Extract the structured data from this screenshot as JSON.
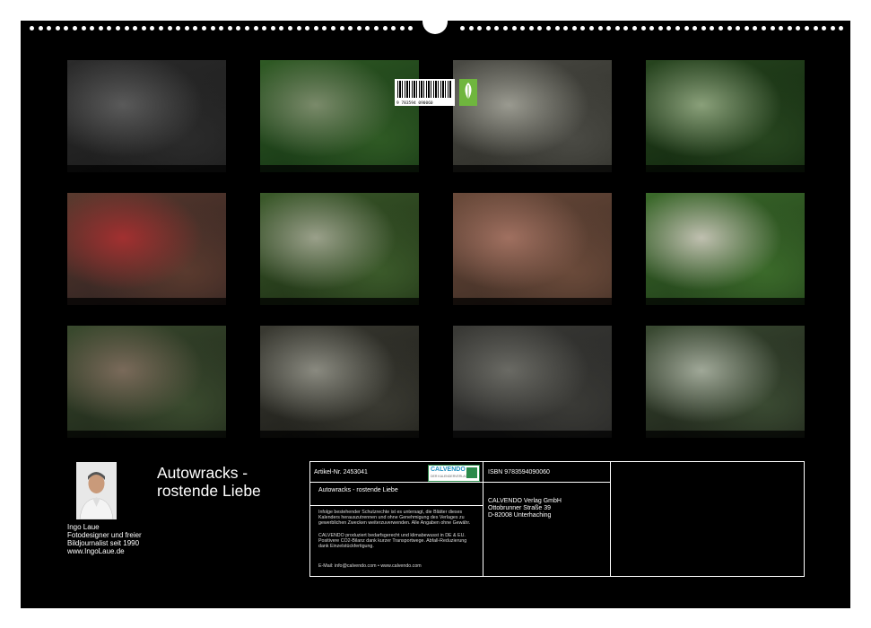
{
  "calendar": {
    "title_line1": "Autowracks -",
    "title_line2": "rostende Liebe",
    "photos": [
      {
        "caption": "",
        "palette": [
          "#2b2b2b",
          "#5a5a5a",
          "#1a1a1a"
        ]
      },
      {
        "caption": "",
        "palette": [
          "#2f5a24",
          "#7a8a6a",
          "#123012"
        ]
      },
      {
        "caption": "",
        "palette": [
          "#4a4a44",
          "#9a9a90",
          "#2a2a24"
        ]
      },
      {
        "caption": "",
        "palette": [
          "#27451f",
          "#8aa07a",
          "#0f240c"
        ]
      },
      {
        "caption": "",
        "palette": [
          "#5a3a2e",
          "#a23030",
          "#2a2020"
        ]
      },
      {
        "caption": "",
        "palette": [
          "#3b5a2a",
          "#9aa08a",
          "#1a2a12"
        ]
      },
      {
        "caption": "",
        "palette": [
          "#6a4a3a",
          "#a07060",
          "#3a2a22"
        ]
      },
      {
        "caption": "",
        "palette": [
          "#3b6a2a",
          "#c0c0b0",
          "#1e3a18"
        ]
      },
      {
        "caption": "",
        "palette": [
          "#3a4a2e",
          "#7a6a5a",
          "#1a2216"
        ]
      },
      {
        "caption": "",
        "palette": [
          "#3a3a32",
          "#8a8a80",
          "#1a1a16"
        ]
      },
      {
        "caption": "",
        "palette": [
          "#3a3a36",
          "#6a6a64",
          "#222"
        ]
      },
      {
        "caption": "",
        "palette": [
          "#3a4a32",
          "#a0a898",
          "#1a1e16"
        ]
      }
    ]
  },
  "author": {
    "name": "Ingo Laue",
    "line2": "Fotodesigner und freier",
    "line3": "Bildjournalist seit 1990",
    "line4": "www.IngoLaue.de"
  },
  "info": {
    "artikel": "Artikel-Nr. 2453041",
    "product_title": "Autowracks - rostende Liebe",
    "legal1": "Infolge bestehender Schutzrechte ist es untersagt, die Blätter dieses Kalenders herauszutrennen und ohne Genehmigung des Verlages zu gewerblichen Zwecken weiterzuverwenden. Alle Angaben ohne Gewähr.",
    "legal2": "CALVENDO produziert bedarfsgerecht und klimabewusst in DE & EU. Positivere CO2-Bilanz dank kurzer Transportwege. Abfall-Reduzierung dank Einzelstückfertigung.",
    "contact": "E-Mail: info@calvendo.com • www.calvendo.com",
    "isbn": "ISBN 9783594090060",
    "publisher": "CALVENDO Verlag GmbH",
    "street": "Ottobrunner Straße 39",
    "city": "D-82008 Unterhaching",
    "logo_name": "CALVENDO",
    "logo_sub": "DER KALENDERVERLAG",
    "barcode_number": "9 783594 090060"
  },
  "icons": {
    "leaf": "eco-leaf-icon"
  }
}
